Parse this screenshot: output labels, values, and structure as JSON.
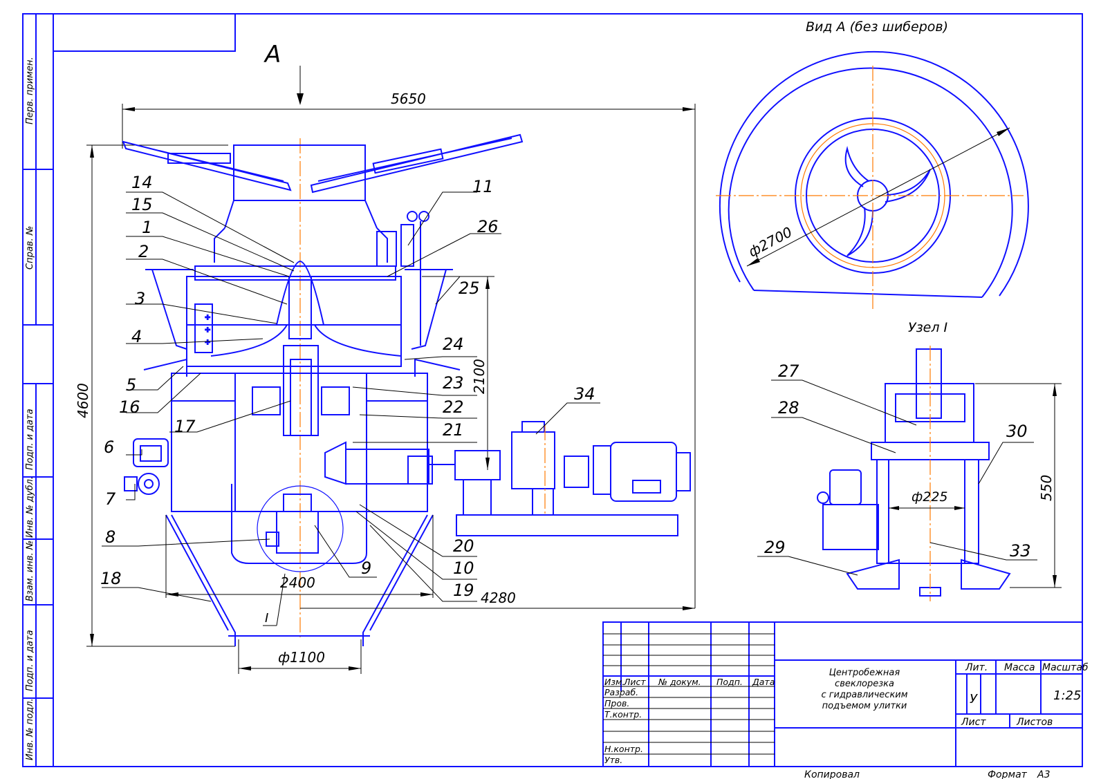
{
  "view_a_title": "Вид А (без шиберов)",
  "node_title": "Узел I",
  "view_arrow_letter": "А",
  "node_marker": "I",
  "dimensions": {
    "overall_width": "5650",
    "overall_height": "4600",
    "height_2100": "2100",
    "width_2400": "2400",
    "width_4280": "4280",
    "outlet_diameter": "ф1100",
    "view_a_diameter": "ф2700",
    "node_height": "550",
    "node_diameter": "ф225"
  },
  "part_numbers": {
    "p1": "1",
    "p2": "2",
    "p3": "3",
    "p4": "4",
    "p5": "5",
    "p6": "6",
    "p7": "7",
    "p8": "8",
    "p9": "9",
    "p10": "10",
    "p11": "11",
    "p14": "14",
    "p15": "15",
    "p16": "16",
    "p17": "17",
    "p18": "18",
    "p19": "19",
    "p20": "20",
    "p21": "21",
    "p22": "22",
    "p23": "23",
    "p24": "24",
    "p25": "25",
    "p26": "26",
    "p27": "27",
    "p28": "28",
    "p29": "29",
    "p30": "30",
    "p33": "33",
    "p34": "34"
  },
  "left_strip": {
    "perv_primen": "Перв. примен.",
    "sprav_no": "Справ. №",
    "podp_data_1": "Подп. и дата",
    "inv_dubl": "Инв. № дубл.",
    "vzam_inv": "Взам. инв. №",
    "podp_data_2": "Подп. и дата",
    "inv_podl": "Инв. № подл."
  },
  "title_block": {
    "title_line1": "Центробежная",
    "title_line2": "свеклорезка",
    "title_line3": "с гидравлическим",
    "title_line4": "подъемом улитки",
    "izm": "Изм.",
    "list": "Лист",
    "doc_no": "№ докум.",
    "podp": "Подп.",
    "data": "Дата",
    "razrab": "Разраб.",
    "prov": "Пров.",
    "tkontr": "Т.контр.",
    "nkontr": "Н.контр.",
    "utv": "Утв.",
    "lit": "Лит.",
    "massa": "Масса",
    "masshtab": "Масштаб",
    "lit_value": "У",
    "scale_value": "1:25",
    "sheet_label": "Лист",
    "sheets_label": "Листов",
    "copied": "Копировал",
    "format_label": "Формат",
    "format_value": "А3"
  }
}
